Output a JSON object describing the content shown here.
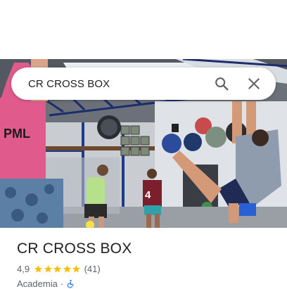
{
  "search": {
    "query": "CR CROSS BOX",
    "search_icon": "search-icon",
    "close_icon": "close-icon"
  },
  "photo": {
    "description_icon": "gym-photo",
    "jersey_number": "4"
  },
  "place": {
    "name": "CR CROSS BOX",
    "rating": "4,9",
    "stars": 5,
    "review_count": "(41)",
    "category": "Academia",
    "separator": "·",
    "accessibility_icon": "wheelchair-icon"
  },
  "colors": {
    "star": "#fbbc04",
    "accessibility": "#1a73e8",
    "text_primary": "#202124",
    "text_secondary": "#5f6368"
  }
}
